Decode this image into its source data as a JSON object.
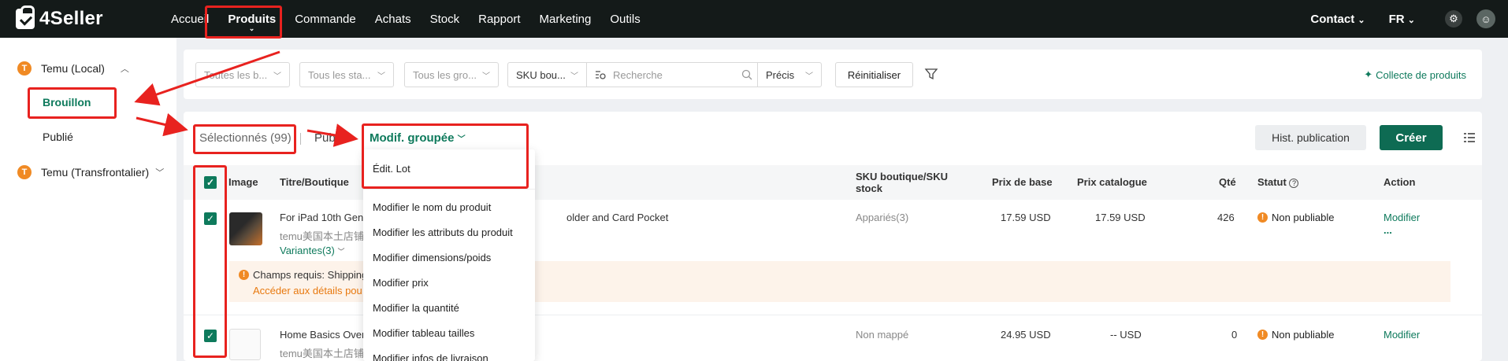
{
  "brand": {
    "name": "4Seller"
  },
  "nav": {
    "items": [
      "Accueil",
      "Produits",
      "Commande",
      "Achats",
      "Stock",
      "Rapport",
      "Marketing",
      "Outils"
    ],
    "active": "Produits",
    "contact": "Contact",
    "language": "FR"
  },
  "sidebar": {
    "stores": [
      {
        "badge": "T",
        "name": "Temu (Local)",
        "expanded": true,
        "subs": [
          "Brouillon",
          "Publié"
        ]
      },
      {
        "badge": "T",
        "name": "Temu (Transfrontalier)",
        "expanded": false
      }
    ],
    "active_sub": "Brouillon"
  },
  "filters": {
    "brand_placeholder": "Toutes les b...",
    "status_placeholder": "Tous les sta...",
    "group_placeholder": "Tous les gro...",
    "sku_type": "SKU bou...",
    "search_placeholder": "Recherche",
    "match_mode": "Précis",
    "reset_label": "Réinitialiser",
    "collect_label": "Collecte de produits"
  },
  "toolbar": {
    "selected_label": "Sélectionnés (99)",
    "publish_tab": "Publi",
    "bulk_edit_label": "Modif. groupée",
    "history_label": "Hist. publication",
    "create_label": "Créer"
  },
  "bulk_menu": {
    "items": [
      "Édit. Lot",
      "Modifier le nom du produit",
      "Modifier les attributs du produit",
      "Modifier dimensions/poids",
      "Modifier prix",
      "Modifier la quantité",
      "Modifier tableau tailles",
      "Modifier infos de livraison"
    ]
  },
  "table": {
    "headers": {
      "image": "Image",
      "title": "Titre/Boutique",
      "sku_line1": "SKU boutique/SKU",
      "sku_line2": "stock",
      "base_price": "Prix de base",
      "list_price": "Prix catalogue",
      "qty": "Qté",
      "status": "Statut",
      "action": "Action"
    },
    "rows": [
      {
        "title": "For iPad 10th Gene",
        "title_tail": "older and Card Pocket",
        "shop": "temu美国本土店铺",
        "variants": "Variantes(3)",
        "sku": "Appariés(3)",
        "base_price": "17.59 USD",
        "list_price": "17.59 USD",
        "qty": "426",
        "status": "Non publiable",
        "action": "Modifier",
        "more": "...",
        "warning_text": "Champs requis: Shipping",
        "warning_link": "Accéder aux détails pou"
      },
      {
        "title": "Home Basics Over",
        "shop": "temu美国本土店铺",
        "sku": "Non mappé",
        "base_price": "24.95 USD",
        "list_price": "-- USD",
        "qty": "0",
        "status": "Non publiable",
        "action": "Modifier"
      }
    ]
  },
  "colors": {
    "accent": "#0e7a5c",
    "topbar": "#141a19",
    "warning": "#f08a24",
    "annotation": "#e8221f"
  },
  "icons": [
    "search-icon",
    "filter-icon",
    "sparkle-icon",
    "settings-icon",
    "avatar-icon",
    "list-settings-icon",
    "help-icon"
  ]
}
